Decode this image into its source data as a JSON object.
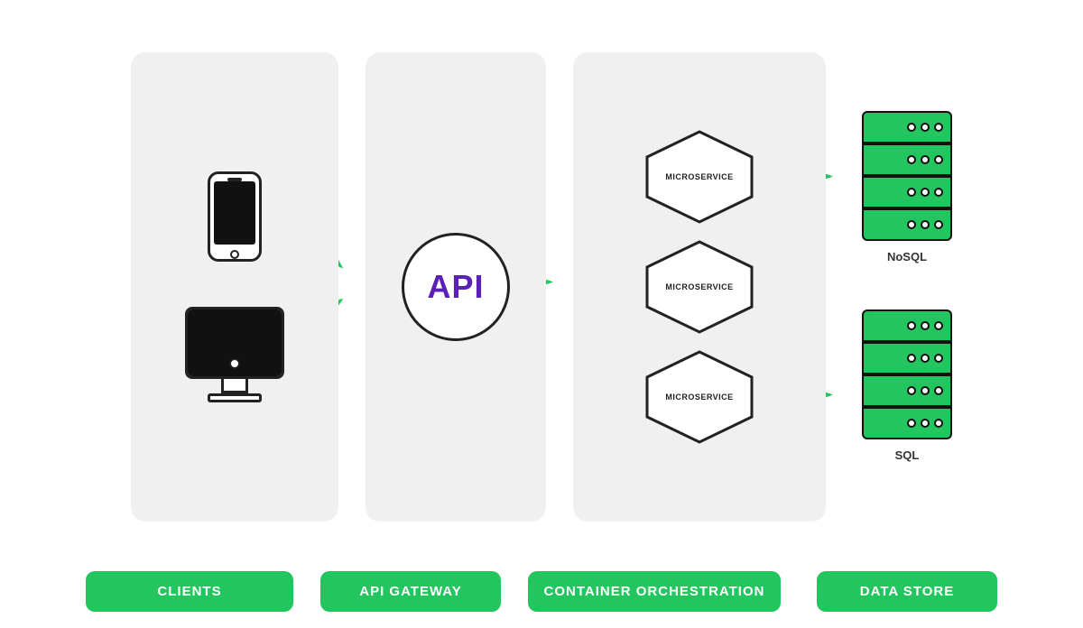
{
  "labels": {
    "clients": "CLIENTS",
    "api_gateway": "API GATEWAY",
    "container_orchestration": "CONTAINER ORCHESTRATION",
    "data_store": "DATA STORE"
  },
  "api": {
    "text": "API"
  },
  "microservices": [
    {
      "label": "MICROSERVICE"
    },
    {
      "label": "MICROSERVICE"
    },
    {
      "label": "MICROSERVICE"
    }
  ],
  "databases": [
    {
      "label": "NoSQL"
    },
    {
      "label": "SQL"
    }
  ],
  "colors": {
    "green": "#22c55e",
    "purple": "#5b21b6",
    "dark": "#111111",
    "panel_bg": "#f0f0f0",
    "white": "#ffffff"
  }
}
